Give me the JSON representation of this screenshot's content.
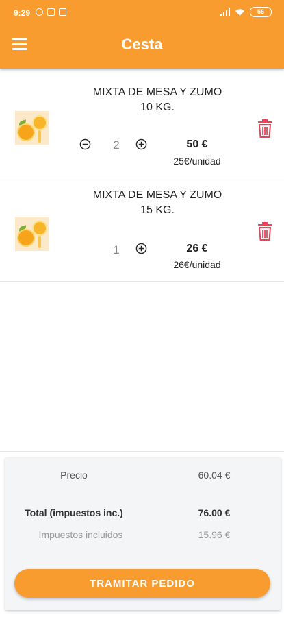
{
  "status_bar": {
    "time": "9:29",
    "battery": "56"
  },
  "header": {
    "title": "Cesta"
  },
  "colors": {
    "accent": "#f89c30",
    "delete": "#e8455a",
    "background": "#ffffff"
  },
  "icons": {
    "menu": "menu-icon",
    "minus": "minus-circle-icon",
    "plus": "plus-circle-icon",
    "delete": "trash-icon"
  },
  "cart": {
    "items": [
      {
        "name_line1": "MIXTA DE MESA Y ZUMO",
        "name_line2": "10 KG.",
        "quantity": "2",
        "price": "50 €",
        "unit_price": "25€/unidad"
      },
      {
        "name_line1": "MIXTA DE MESA Y ZUMO",
        "name_line2": "15 KG.",
        "quantity": "1",
        "price": "26 €",
        "unit_price": "26€/unidad"
      }
    ]
  },
  "summary": {
    "price_label": "Precio",
    "price_value": "60.04 €",
    "total_label": "Total (impuestos inc.)",
    "total_value": "76.00 €",
    "tax_label": "Impuestos incluidos",
    "tax_value": "15.96 €"
  },
  "checkout_label": "TRAMITAR PEDIDO"
}
